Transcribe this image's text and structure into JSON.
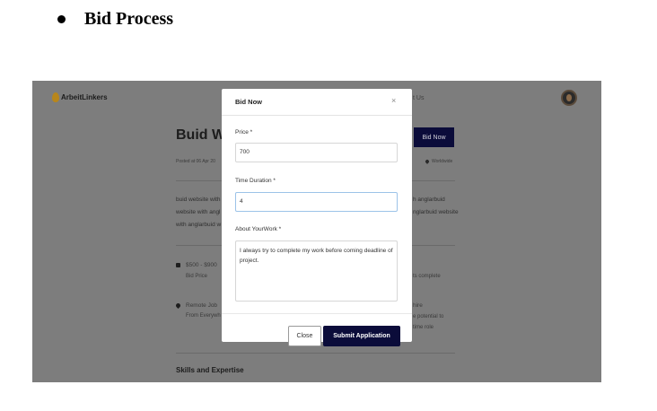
{
  "document": {
    "heading": "Bid Process"
  },
  "background_page": {
    "logo_text": "ArbeitLinkers",
    "nav_partial": "t Us",
    "title_partial": "Buid We",
    "bid_button": "Bid Now",
    "posted_partial": "Posted at 06 Apr 20",
    "location": "Worldwide",
    "desc_left": [
      "buid website with",
      "website with angl",
      "with anglarbuid w"
    ],
    "desc_right": [
      "h anglarbuid",
      "nglarbuid website"
    ],
    "price_range_partial": "$500 - $900",
    "price_label": "Bid Price",
    "right_mid_partial": "ts complete",
    "remote_partial": "Remote Job",
    "remote_sub_partial": "From Everywh",
    "hire_partial": "hire",
    "potential_partial": "e potential to",
    "role_partial": "time role",
    "skills_heading": "Skills and Expertise"
  },
  "modal": {
    "title": "Bid Now",
    "close_symbol": "×",
    "price_label": "Price *",
    "price_value": "700",
    "duration_label": "Time Duration *",
    "duration_value": "4",
    "about_label": "About YourWork *",
    "about_value": "I always try to complete my work before coming deadline of project.",
    "close_button": "Close",
    "submit_button": "Submit Application"
  },
  "colors": {
    "overlay": "#7d7d7d",
    "brand_navy": "#0b0c3a",
    "logo_flame": "#b8861b"
  }
}
